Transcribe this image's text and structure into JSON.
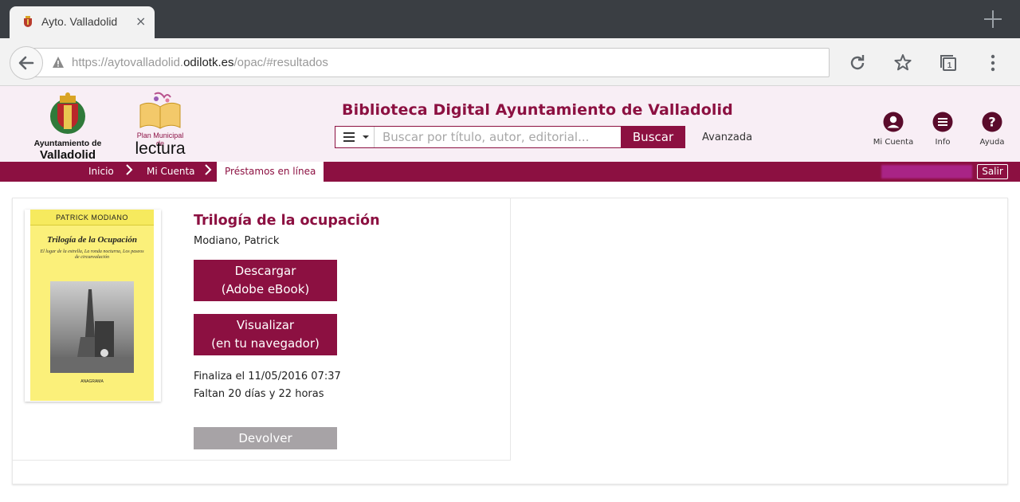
{
  "browser": {
    "tab_title": "Ayto. Valladolid",
    "tab_close": "×",
    "url_prefix": "https://aytovalladolid.",
    "url_host": "odilotk.es",
    "url_suffix": "/opac/#resultados"
  },
  "header": {
    "logo_valladolid_line1": "Ayuntamiento de",
    "logo_valladolid_line2": "Valladolid",
    "logo_plan_line1": "Plan Municipal de",
    "logo_plan_line2": "lectura",
    "site_title": "Biblioteca Digital Ayuntamiento de Valladolid",
    "search_placeholder": "Buscar por título, autor, editorial...",
    "search_button": "Buscar",
    "advanced_link": "Avanzada",
    "icons": [
      {
        "name": "Mi Cuenta",
        "icon": "user-icon"
      },
      {
        "name": "Info",
        "icon": "menu-icon"
      },
      {
        "name": "Ayuda",
        "icon": "help-icon"
      }
    ]
  },
  "nav": {
    "breadcrumbs": [
      "Inicio",
      "Mi Cuenta",
      "Préstamos en línea"
    ],
    "logout_button": "Salir"
  },
  "book": {
    "cover_author": "PATRICK MODIANO",
    "cover_title": "Trilogía de la Ocupación",
    "cover_subtitle": "El lugar de la estrella, La ronda nocturna, Los paseos de circunvalación",
    "cover_publisher": "ANAGRAMA",
    "title": "Trilogía de la ocupación",
    "author": "Modiano, Patrick",
    "download_line1": "Descargar",
    "download_line2": "(Adobe eBook)",
    "view_line1": "Visualizar",
    "view_line2": "(en tu navegador)",
    "due_date": "Finaliza el 11/05/2016 07:37",
    "remaining": "Faltan 20 días y 22 horas",
    "return_button": "Devolver"
  },
  "colors": {
    "brand": "#8c1041",
    "header_bg": "#f8eef5",
    "disabled_button": "#a7a3a6"
  }
}
